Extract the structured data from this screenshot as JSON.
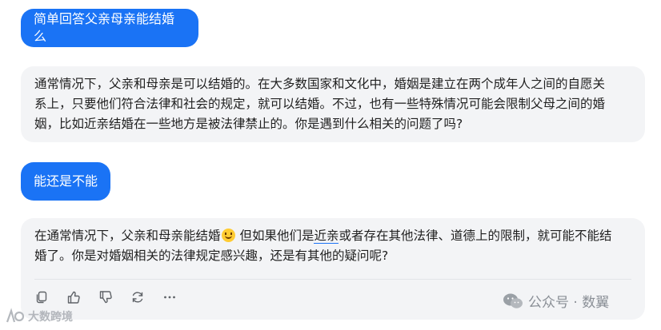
{
  "messages": {
    "q1": "简单回答父亲母亲能结婚么",
    "a1_lines": [
      "通常情况下，父亲和母亲是可以结婚的。在大多数国家和文化中，婚姻是建立在两个成年人之间的自愿关",
      "系上，只要他们符合法律和社会的规定，就可以结婚。不过，也有一些特殊情况可能会限制父母之间的婚",
      "姻，比如近亲结婚在一些地方是被法律禁止的。你是遇到什么相关的问题了吗?"
    ],
    "q2": "能还是不能",
    "a2_line1_before": "在通常情况下，父亲和母亲能结婚",
    "a2_line1_after_a": " 但如果他们是",
    "a2_line1_link": "近亲",
    "a2_line1_after_b": "或者存在其他法律、道德上的限制，就可能不能结",
    "a2_line2": "婚了。你是对婚姻相关的法律规定感兴趣，还是有其他的疑问呢?",
    "emoji": "smiling-face"
  },
  "actions": [
    "copy-icon",
    "thumbs-up-icon",
    "thumbs-down-icon",
    "regenerate-icon",
    "more-icon"
  ],
  "watermarks": {
    "left_text": "大数跨境",
    "right_text": "公众号 · 数翼"
  },
  "colors": {
    "user_bubble": "#1a73f5",
    "bot_bubble": "#f3f4f6",
    "text": "#1f1f1f"
  }
}
